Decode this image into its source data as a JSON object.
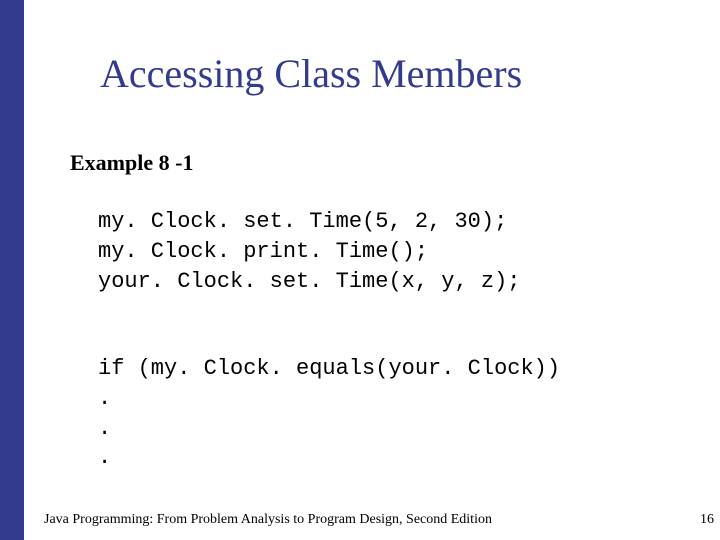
{
  "title": "Accessing Class Members",
  "example_label": "Example 8 -1",
  "code": {
    "block1": [
      "my. Clock. set. Time(5, 2, 30);",
      "my. Clock. print. Time();",
      "your. Clock. set. Time(x, y, z);"
    ],
    "block2": [
      "if (my. Clock. equals(your. Clock))",
      ".",
      ".",
      "."
    ]
  },
  "footer": {
    "left": "Java Programming: From Problem Analysis to Program Design, Second Edition",
    "right": "16"
  }
}
